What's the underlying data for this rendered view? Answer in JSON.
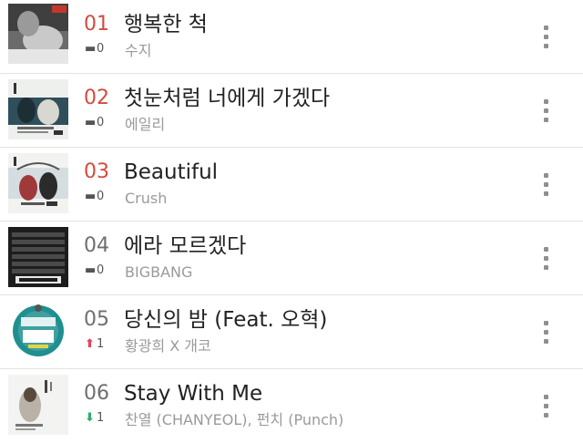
{
  "chart": {
    "items": [
      {
        "rank": "01",
        "change_icon": "no-change",
        "change_value": "0",
        "title": "행복한 척",
        "artist": "수지"
      },
      {
        "rank": "02",
        "change_icon": "no-change",
        "change_value": "0",
        "title": "첫눈처럼 너에게 가겠다",
        "artist": "에일리"
      },
      {
        "rank": "03",
        "change_icon": "no-change",
        "change_value": "0",
        "title": "Beautiful",
        "artist": "Crush"
      },
      {
        "rank": "04",
        "change_icon": "no-change",
        "change_value": "0",
        "title": "에라 모르겠다",
        "artist": "BIGBANG"
      },
      {
        "rank": "05",
        "change_icon": "rank-up",
        "change_value": "1",
        "title": "당신의 밤 (Feat. 오혁)",
        "artist": "황광희 X 개코"
      },
      {
        "rank": "06",
        "change_icon": "rank-down",
        "change_value": "1",
        "title": "Stay With Me",
        "artist": "찬열 (CHANYEOL), 펀치 (Punch)"
      }
    ]
  },
  "colors": {
    "top_rank": "#d64a3e",
    "rank": "#6f6f6f",
    "rank_up": "#e0455a",
    "rank_down": "#2fae6b",
    "artist": "#9a9a9a"
  },
  "icons": {
    "no_change": "dash-icon",
    "up": "up-arrow-icon",
    "down": "down-arrow-icon",
    "more": "more-vertical-icon"
  }
}
